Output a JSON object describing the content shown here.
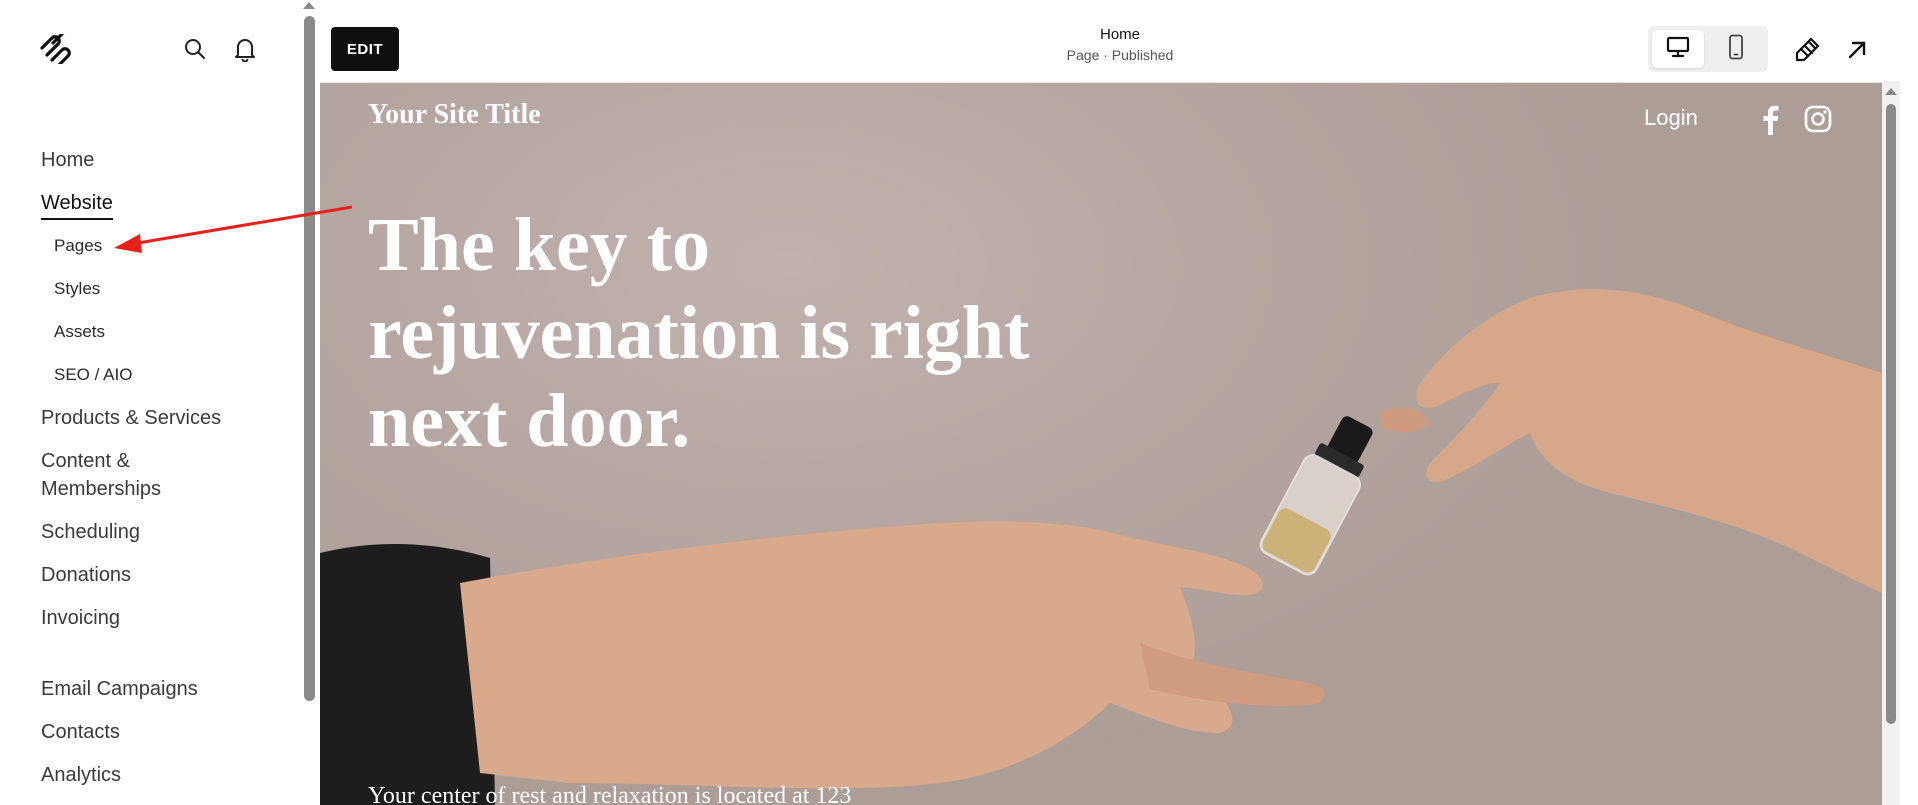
{
  "sidebar": {
    "logo_icon": "squarespace-logo-icon",
    "search_icon": "search-icon",
    "notifications_icon": "bell-icon",
    "items": [
      {
        "label": "Home"
      },
      {
        "label": "Website"
      },
      {
        "label": "Pages"
      },
      {
        "label": "Styles"
      },
      {
        "label": "Assets"
      },
      {
        "label": "SEO / AIO"
      },
      {
        "label": "Products & Services"
      },
      {
        "label": "Content &"
      },
      {
        "label": "Memberships"
      },
      {
        "label": "Scheduling"
      },
      {
        "label": "Donations"
      },
      {
        "label": "Invoicing"
      },
      {
        "label": "Email Campaigns"
      },
      {
        "label": "Contacts"
      },
      {
        "label": "Analytics"
      }
    ]
  },
  "toolbar": {
    "edit_label": "EDIT",
    "page_title": "Home",
    "page_status": "Page · Published",
    "desktop_icon": "desktop-icon",
    "mobile_icon": "mobile-icon",
    "design_icon": "paintbrush-icon",
    "open_icon": "external-arrow-icon"
  },
  "preview": {
    "site_title": "Your Site Title",
    "login_label": "Login",
    "facebook_icon": "facebook-icon",
    "instagram_icon": "instagram-icon",
    "hero_heading_line1": "The key to",
    "hero_heading_line2": "rejuvenation is right",
    "hero_heading_line3": "next door.",
    "hero_subtext": "Your center of rest and relaxation is located at 123"
  },
  "colors": {
    "accent_dark": "#0f0f0f",
    "hero_background": "#b7a7a2",
    "annotation_arrow": "#e8201a"
  }
}
